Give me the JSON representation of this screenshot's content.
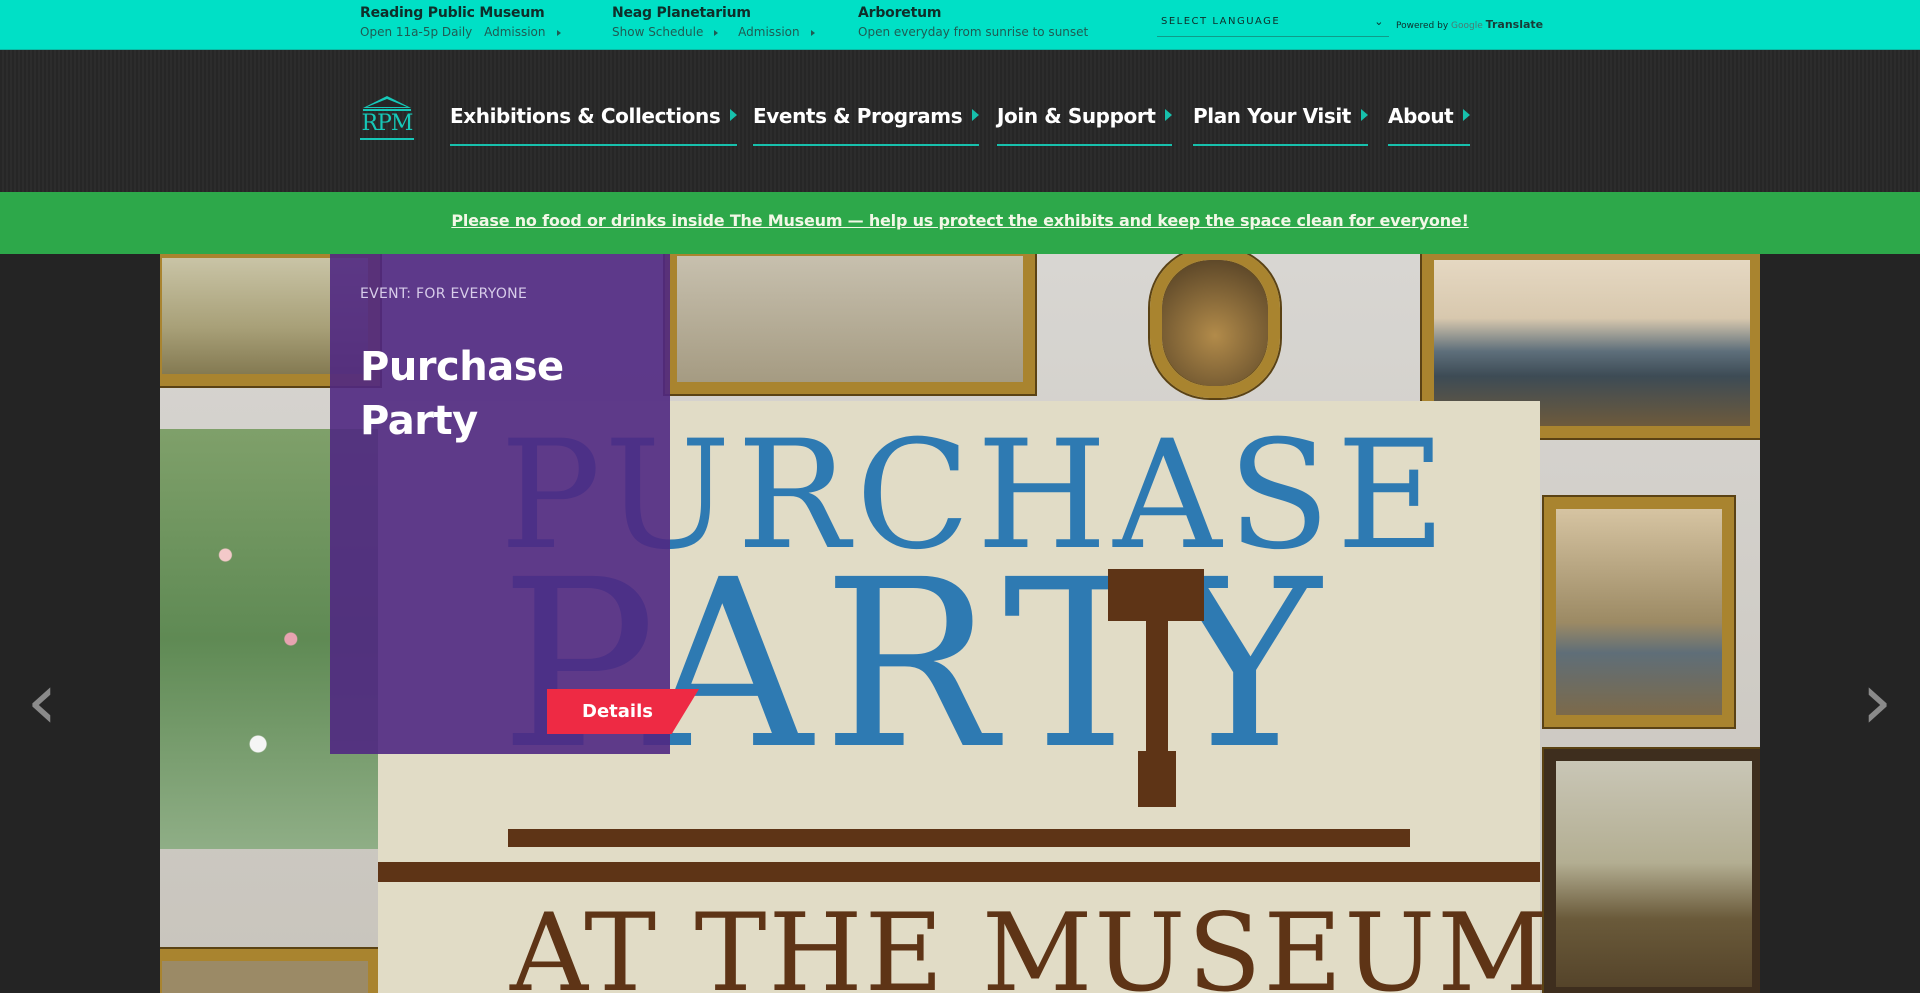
{
  "topbar": {
    "venues": [
      {
        "name": "Reading Public Museum",
        "links": [
          "Open 11a-5p Daily",
          "Admission"
        ]
      },
      {
        "name": "Neag Planetarium",
        "links": [
          "Show Schedule",
          "Admission"
        ]
      },
      {
        "name": "Arboretum",
        "links": [
          "Open everyday from sunrise to sunset"
        ]
      }
    ],
    "language_select": "SELECT LANGUAGE",
    "powered_by": "Powered by",
    "google": "Google",
    "translate": "Translate"
  },
  "nav": {
    "logo_text": "RPM",
    "items": [
      "Exhibitions & Collections",
      "Events & Programs",
      "Join & Support",
      "Plan Your Visit",
      "About"
    ]
  },
  "notice": "Please no food or drinks inside The Museum — help us protect the exhibits and keep the space clean for everyone!",
  "hero": {
    "eyebrow": "EVENT: FOR EVERYONE",
    "title": "Purchase Party",
    "details_label": "Details",
    "poster_line1": "PURCHASE",
    "poster_line2": "PARTY",
    "poster_line3": "AT THE MUSEUM",
    "prev_arrow": "‹",
    "next_arrow": "›"
  },
  "colors": {
    "topbar": "#00e0c6",
    "accent": "#17c0ac",
    "notice_bg": "#2da84a",
    "overlay": "#502882",
    "details": "#ee2a44",
    "poster_blue": "#2e7ab2",
    "poster_brown": "#5e3416"
  }
}
